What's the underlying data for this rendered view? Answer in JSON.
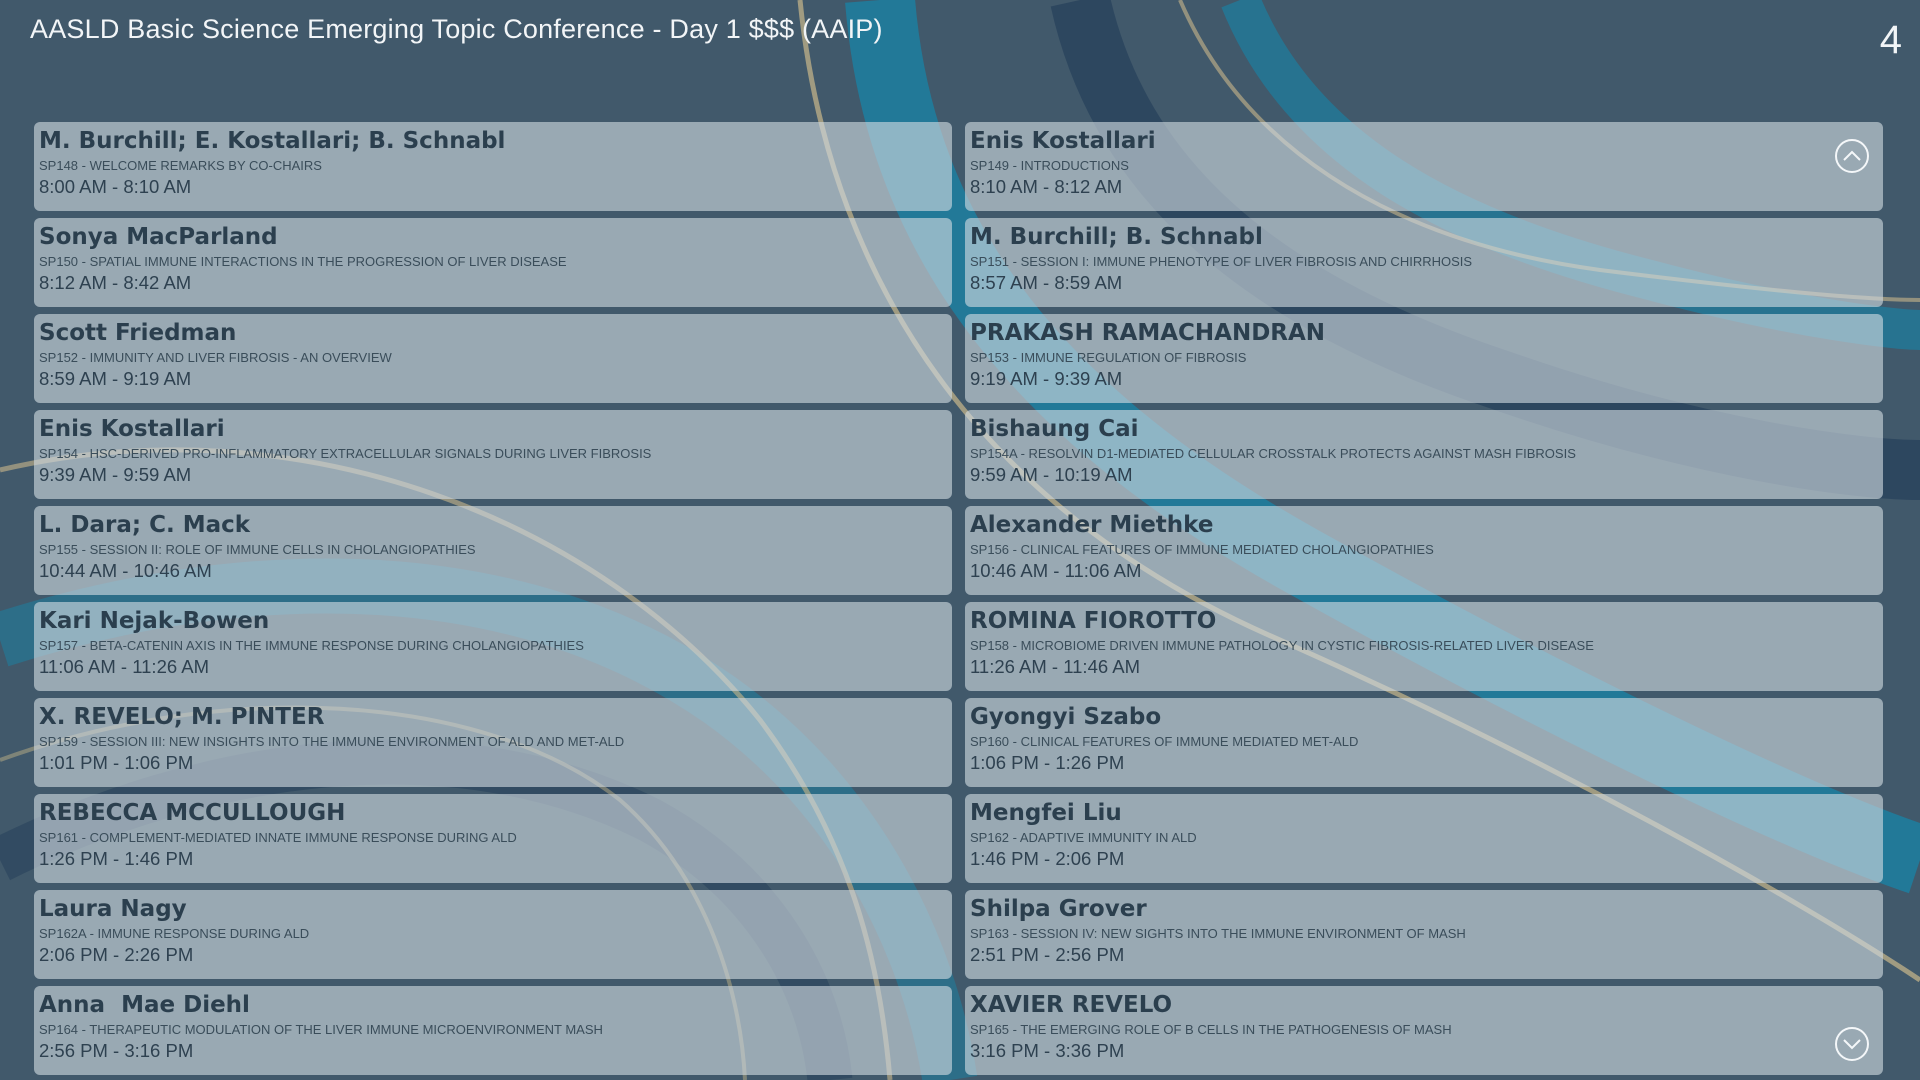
{
  "header": {
    "title": "AASLD Basic Science Emerging Topic Conference - Day 1 $$$ (AAIP)",
    "page_number": "4"
  },
  "colors": {
    "background": "#41596b",
    "card": "#c8d4dc",
    "accent_teal": "#1d7fa0",
    "accent_navy": "#28425c",
    "arc_gold": "#c9b88a"
  },
  "icons": {
    "scroll_up": "chevron-up-circle-icon",
    "scroll_down": "chevron-down-circle-icon"
  },
  "sessions": [
    {
      "speaker": "M. Burchill; E. Kostallari; B. Schnabl",
      "topic": "Sp148 - WELCOME REMARKS BY CO-CHAIRS",
      "time": "8:00 AM - 8:10 AM"
    },
    {
      "speaker": "Enis Kostallari",
      "topic": "Sp149 - INTRODUCTIONS",
      "time": "8:10 AM - 8:12 AM"
    },
    {
      "speaker": "Sonya MacParland",
      "topic": "Sp150 - SPATIAL IMMUNE INTERACTIONS IN THE PROGRESSION OF LIVER DISEASE",
      "time": "8:12 AM - 8:42 AM"
    },
    {
      "speaker": "M. Burchill; B. Schnabl",
      "topic": "Sp151 - SESSION I: IMMUNE PHENOTYPE OF LIVER FIBROSIS AND CHIRRHOSIS",
      "time": "8:57 AM - 8:59 AM"
    },
    {
      "speaker": "Scott Friedman",
      "topic": "Sp152 - IMMUNITY AND LIVER FIBROSIS - AN OVERVIEW",
      "time": "8:59 AM - 9:19 AM"
    },
    {
      "speaker": "PRAKASH RAMACHANDRAN",
      "topic": "Sp153 - IMMUNE REGULATION OF FIBROSIS",
      "time": "9:19 AM - 9:39 AM"
    },
    {
      "speaker": "Enis Kostallari",
      "topic": "Sp154 - HSC-DERIVED PRO-INFLAMMATORY EXTRACELLULAR SIGNALS DURING LIVER FIBROSIS",
      "time": "9:39 AM - 9:59 AM"
    },
    {
      "speaker": "Bishaung Cai",
      "topic": "Sp154a - RESOLVIN D1-MEDIATED CELLULAR CROSSTALK PROTECTS AGAINST MASH FIBROSIS",
      "time": "9:59 AM - 10:19 AM"
    },
    {
      "speaker": "L. Dara; C. Mack",
      "topic": "Sp155 - SESSION II: ROLE OF IMMUNE CELLS IN CHOLANGIOPATHIES",
      "time": "10:44 AM - 10:46 AM"
    },
    {
      "speaker": "Alexander Miethke",
      "topic": "Sp156 - CLINICAL FEATURES OF IMMUNE MEDIATED CHOLANGIOPATHIES",
      "time": "10:46 AM - 11:06 AM"
    },
    {
      "speaker": "Kari Nejak-Bowen",
      "topic": "Sp157 - BETA-CATENIN AXIS IN THE IMMUNE RESPONSE DURING CHOLANGIOPATHIES",
      "time": "11:06 AM - 11:26 AM"
    },
    {
      "speaker": "ROMINA FIOROTTO",
      "topic": "Sp158 - MICROBIOME DRIVEN IMMUNE PATHOLOGY IN CYSTIC FIBROSIS-RELATED LIVER DISEASE",
      "time": "11:26 AM - 11:46 AM"
    },
    {
      "speaker": "X. REVELO; M. PINTER",
      "topic": "Sp159 - SESSION III: NEW INSIGHTS INTO THE IMMUNE ENVIRONMENT OF ALD AND MET-ALD",
      "time": "1:01 PM - 1:06 PM"
    },
    {
      "speaker": "Gyongyi Szabo",
      "topic": "Sp160 - CLINICAL FEATURES OF IMMUNE MEDIATED MET-ALD",
      "time": "1:06 PM - 1:26 PM"
    },
    {
      "speaker": "REBECCA MCCULLOUGH",
      "topic": "Sp161 - COMPLEMENT-MEDIATED INNATE IMMUNE RESPONSE DURING ALD",
      "time": "1:26 PM - 1:46 PM"
    },
    {
      "speaker": "Mengfei Liu",
      "topic": "Sp162 - ADAPTIVE IMMUNITY IN ALD",
      "time": "1:46 PM - 2:06 PM"
    },
    {
      "speaker": "Laura Nagy",
      "topic": "Sp162a - IMMUNE RESPONSE DURING ALD",
      "time": "2:06 PM - 2:26 PM"
    },
    {
      "speaker": "Shilpa Grover",
      "topic": "Sp163 - SESSION IV: NEW SIGHTS INTO THE IMMUNE ENVIRONMENT OF MASH",
      "time": "2:51 PM - 2:56 PM"
    },
    {
      "speaker": "Anna  Mae Diehl",
      "topic": "Sp164 - THERAPEUTIC MODULATION OF THE LIVER IMMUNE MICROENVIRONMENT MASH",
      "time": "2:56 PM - 3:16 PM"
    },
    {
      "speaker": "XAVIER REVELO",
      "topic": "Sp165 - THE EMERGING ROLE OF B CELLS IN THE PATHOGENESIS OF MASH",
      "time": "3:16 PM - 3:36 PM"
    }
  ]
}
